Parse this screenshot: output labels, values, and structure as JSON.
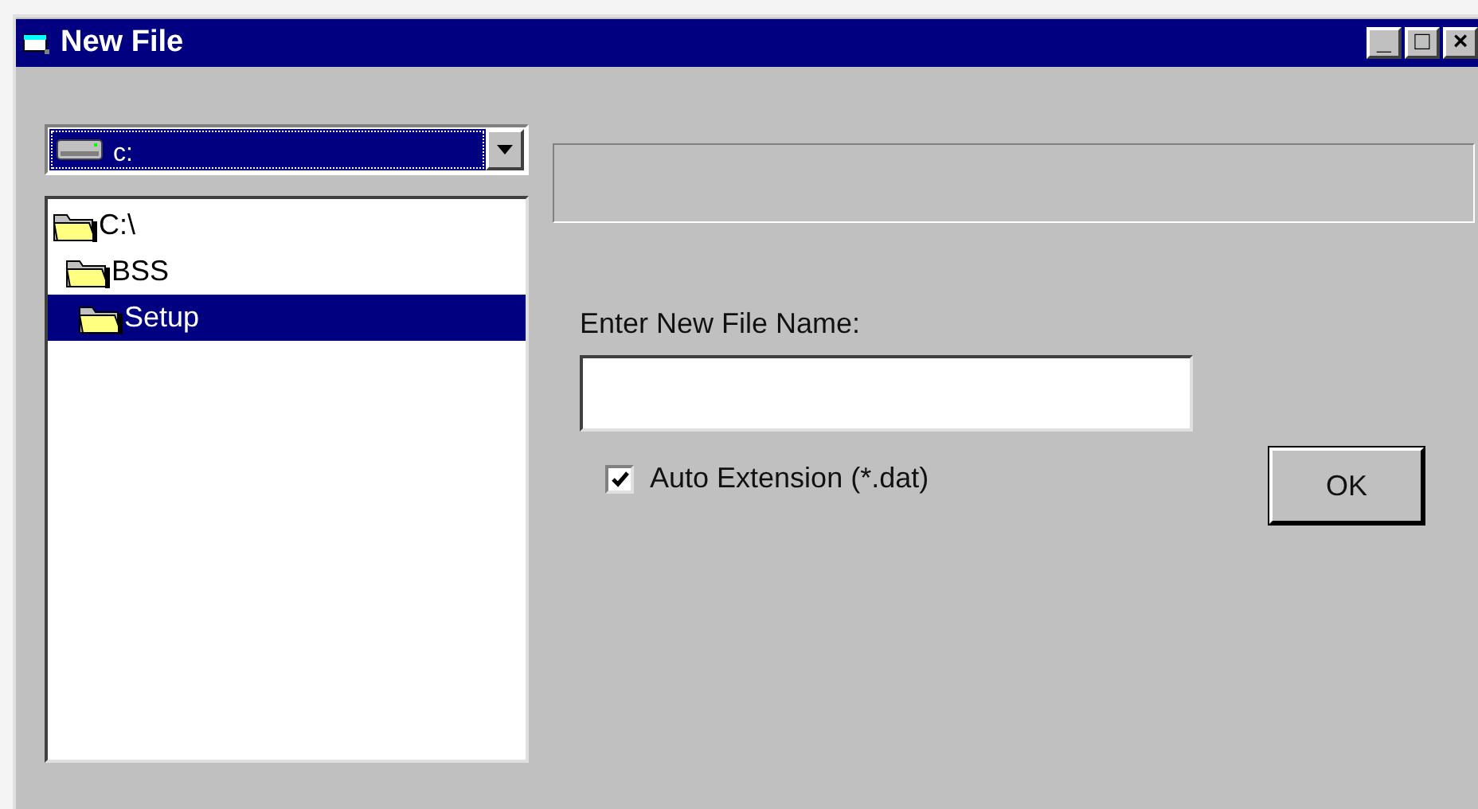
{
  "window": {
    "title": "New File",
    "controls": [
      "_",
      "□",
      "×"
    ]
  },
  "drive": {
    "value": "c:"
  },
  "folders": [
    {
      "label": "C:\\",
      "selected": false,
      "children": [
        {
          "label": "BSS",
          "selected": false,
          "children": [
            {
              "label": "Setup",
              "selected": true
            }
          ]
        }
      ]
    }
  ],
  "file_name": {
    "label": "Enter New File Name:"
  },
  "auto_extension": {
    "label": "Auto Extension (*.dat)",
    "checked": true
  },
  "buttons": [
    "OK"
  ]
}
